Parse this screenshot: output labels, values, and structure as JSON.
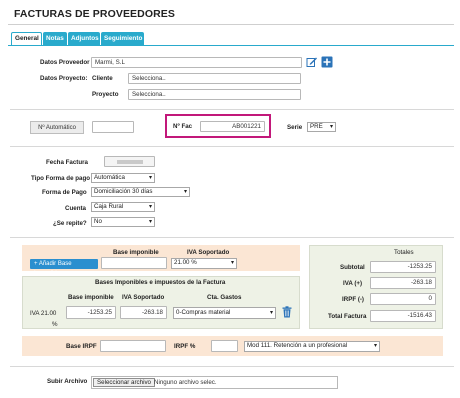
{
  "page": {
    "title": "FACTURAS DE PROVEEDORES"
  },
  "tabs": [
    "General",
    "Notas",
    "Adjuntos",
    "Seguimiento"
  ],
  "datos": {
    "proveedor_label": "Datos Proveedor",
    "proveedor_value": "Marmi, S.L",
    "proyecto_label": "Datos Proyecto:",
    "cliente_label": "Cliente",
    "cliente_value": "Selecciona..",
    "proyecto_sub_label": "Proyecto",
    "proyecto_value": "Selecciona.."
  },
  "numero": {
    "auto_button": "Nº Automático",
    "auto_value": "",
    "nfac_label": "Nº Fac",
    "nfac_value": "AB001221",
    "serie_label": "Serie",
    "serie_value": "PRE"
  },
  "factura": {
    "fecha_label": "Fecha Factura",
    "fecha_value": "",
    "tipo_label": "Tipo Forma de pago",
    "tipo_value": "Automática",
    "forma_label": "Forma de Pago",
    "forma_value": "Domiciliación 30 días",
    "cuenta_label": "Cuenta",
    "cuenta_value": "Caja Rural",
    "repite_label": "¿Se repite?",
    "repite_value": "No"
  },
  "bases": {
    "base_imponible_header": "Base imponible",
    "iva_soportado_header": "IVA Soportado",
    "add_button": "+ Añadir Base Imponible",
    "base_input": "",
    "iva_select": "21.00 %",
    "table_title": "Bases Imponibles e impuestos de la Factura",
    "col_base": "Base imponible",
    "col_iva": "IVA Soportado",
    "col_cta": "Cta. Gastos",
    "row_label_1": "IVA 21.00",
    "row_label_2": "%",
    "row_base": "-1253.25",
    "row_iva": "-263.18",
    "row_cta": "0-Compras material"
  },
  "totales": {
    "header": "Totales",
    "subtotal_label": "Subtotal",
    "subtotal_value": "-1253.25",
    "iva_label": "IVA (+)",
    "iva_value": "-263.18",
    "irpf_label": "IRPF (-)",
    "irpf_value": "0",
    "total_label": "Total Factura",
    "total_value": "-1516.43"
  },
  "irpf": {
    "base_label": "Base IRPF",
    "base_value": "",
    "pct_label": "IRPF %",
    "pct_value": "",
    "modelo_value": "Mod 111. Retención a un profesional"
  },
  "archivo": {
    "label": "Subir Archivo",
    "button": "Seleccionar archivo",
    "status": "Ninguno archivo selec."
  },
  "colors": {
    "tab": "#29aacc",
    "highlight": "#c2187a",
    "peach": "#fbe6d4",
    "green": "#eef2e6",
    "button": "#2b8fcf"
  },
  "icons": [
    "edit-icon",
    "add-icon",
    "trash-icon"
  ]
}
